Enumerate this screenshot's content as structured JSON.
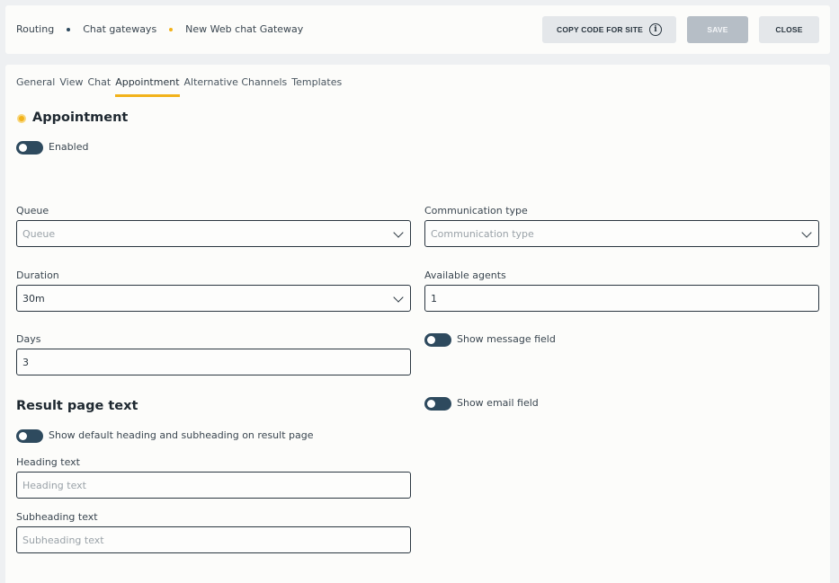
{
  "breadcrumb": {
    "items": [
      "Routing",
      "Chat gateways",
      "New Web chat Gateway"
    ],
    "dot_colors": [
      "#2e4a5e",
      "#f2b21a"
    ]
  },
  "header": {
    "copy_label": "COPY CODE FOR SITE",
    "save_label": "SAVE",
    "close_label": "CLOSE"
  },
  "tabs": [
    {
      "label": "General"
    },
    {
      "label": "View"
    },
    {
      "label": "Chat"
    },
    {
      "label": "Appointment",
      "active": true
    },
    {
      "label": "Alternative Channels"
    },
    {
      "label": "Templates"
    }
  ],
  "appointment": {
    "title": "Appointment",
    "enabled_label": "Enabled"
  },
  "form": {
    "queue": {
      "label": "Queue",
      "placeholder": "Queue"
    },
    "communication_type": {
      "label": "Communication type",
      "placeholder": "Communication type"
    },
    "duration": {
      "label": "Duration",
      "value": "30m"
    },
    "available_agents": {
      "label": "Available agents",
      "value": "1"
    },
    "days": {
      "label": "Days",
      "value": "3"
    },
    "show_message_label": "Show message field",
    "show_email_label": "Show email field"
  },
  "result_page": {
    "title": "Result page text",
    "default_heading_label": "Show default heading and subheading on result page",
    "heading": {
      "label": "Heading text",
      "placeholder": "Heading text"
    },
    "subheading": {
      "label": "Subheading text",
      "placeholder": "Subheading text"
    }
  },
  "colors": {
    "accent": "#f2b21a",
    "toggle": "#2e4a5e",
    "save_disabled": "#b6bec6"
  },
  "icons": [
    "info-icon",
    "chevron-down-icon",
    "appointment-icon"
  ]
}
